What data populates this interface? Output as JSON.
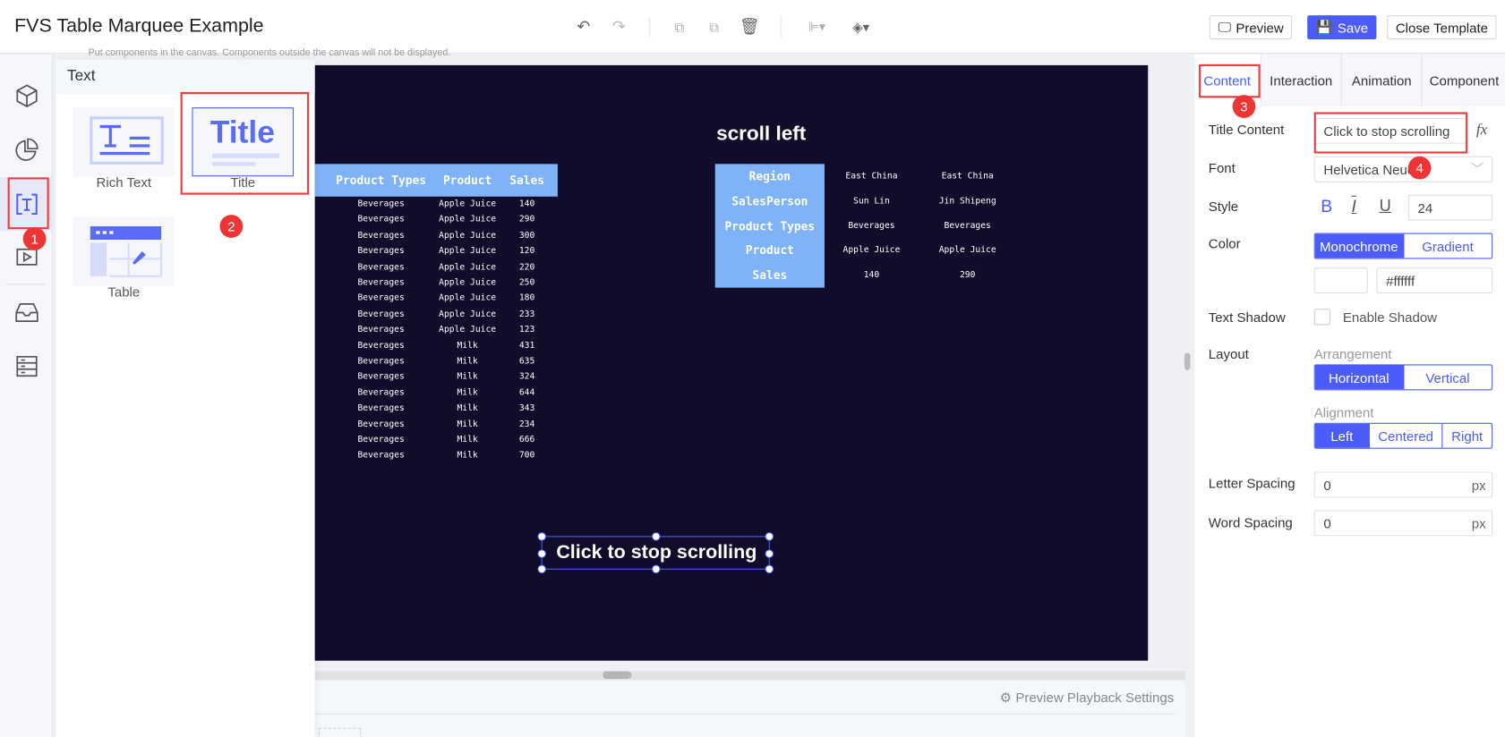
{
  "header": {
    "title": "FVS Table Marquee Example",
    "preview_label": "Preview",
    "save_label": "Save",
    "close_label": "Close Template"
  },
  "canvas_hint": "Put components in the canvas. Components outside the canvas will not be displayed.",
  "component_panel": {
    "title": "Text",
    "items": [
      {
        "label": "Rich Text"
      },
      {
        "label": "Title"
      },
      {
        "label": "Table"
      }
    ]
  },
  "badges": [
    "1",
    "2",
    "3",
    "4"
  ],
  "canvas": {
    "background": "#100c2a",
    "title": "scroll left",
    "left_table": {
      "headers": [
        "Product Types",
        "Product",
        "Sales"
      ],
      "rows": [
        [
          "Beverages",
          "Apple Juice",
          "140"
        ],
        [
          "Beverages",
          "Apple Juice",
          "290"
        ],
        [
          "Beverages",
          "Apple Juice",
          "300"
        ],
        [
          "Beverages",
          "Apple Juice",
          "120"
        ],
        [
          "Beverages",
          "Apple Juice",
          "220"
        ],
        [
          "Beverages",
          "Apple Juice",
          "250"
        ],
        [
          "Beverages",
          "Apple Juice",
          "180"
        ],
        [
          "Beverages",
          "Apple Juice",
          "233"
        ],
        [
          "Beverages",
          "Apple Juice",
          "123"
        ],
        [
          "Beverages",
          "Milk",
          "431"
        ],
        [
          "Beverages",
          "Milk",
          "635"
        ],
        [
          "Beverages",
          "Milk",
          "324"
        ],
        [
          "Beverages",
          "Milk",
          "644"
        ],
        [
          "Beverages",
          "Milk",
          "343"
        ],
        [
          "Beverages",
          "Milk",
          "234"
        ],
        [
          "Beverages",
          "Milk",
          "666"
        ],
        [
          "Beverages",
          "Milk",
          "700"
        ]
      ]
    },
    "right_table": {
      "headers": [
        "Region",
        "SalesPerson",
        "Product Types",
        "Product",
        "Sales"
      ],
      "columns": [
        [
          "East China",
          "Sun Lin",
          "Beverages",
          "Apple Juice",
          "140"
        ],
        [
          "East China",
          "Jin Shipeng",
          "Beverages",
          "Apple Juice",
          "290"
        ]
      ]
    },
    "selected_text": "Click to stop scrolling"
  },
  "bottom": {
    "playback_settings": "Preview Playback Settings"
  },
  "properties": {
    "tabs": [
      "Content",
      "Interaction",
      "Animation",
      "Component"
    ],
    "active_tab": "Content",
    "title_content_label": "Title Content",
    "title_content_value": "Click to stop scrolling",
    "fx": "fx",
    "font_label": "Font",
    "font_value": "Helvetica Neue",
    "style_label": "Style",
    "bold": "B",
    "italic": "I",
    "underline": "U",
    "font_size": "24",
    "color_label": "Color",
    "color_modes": [
      "Monochrome",
      "Gradient"
    ],
    "color_value": "#ffffff",
    "shadow_label": "Text Shadow",
    "shadow_option": "Enable Shadow",
    "layout_label": "Layout",
    "arrangement_label": "Arrangement",
    "arrangement": [
      "Horizontal",
      "Vertical"
    ],
    "alignment_label": "Alignment",
    "alignment": [
      "Left",
      "Centered",
      "Right"
    ],
    "letter_spacing_label": "Letter Spacing",
    "letter_spacing": "0",
    "word_spacing_label": "Word Spacing",
    "word_spacing": "0",
    "unit": "px"
  }
}
